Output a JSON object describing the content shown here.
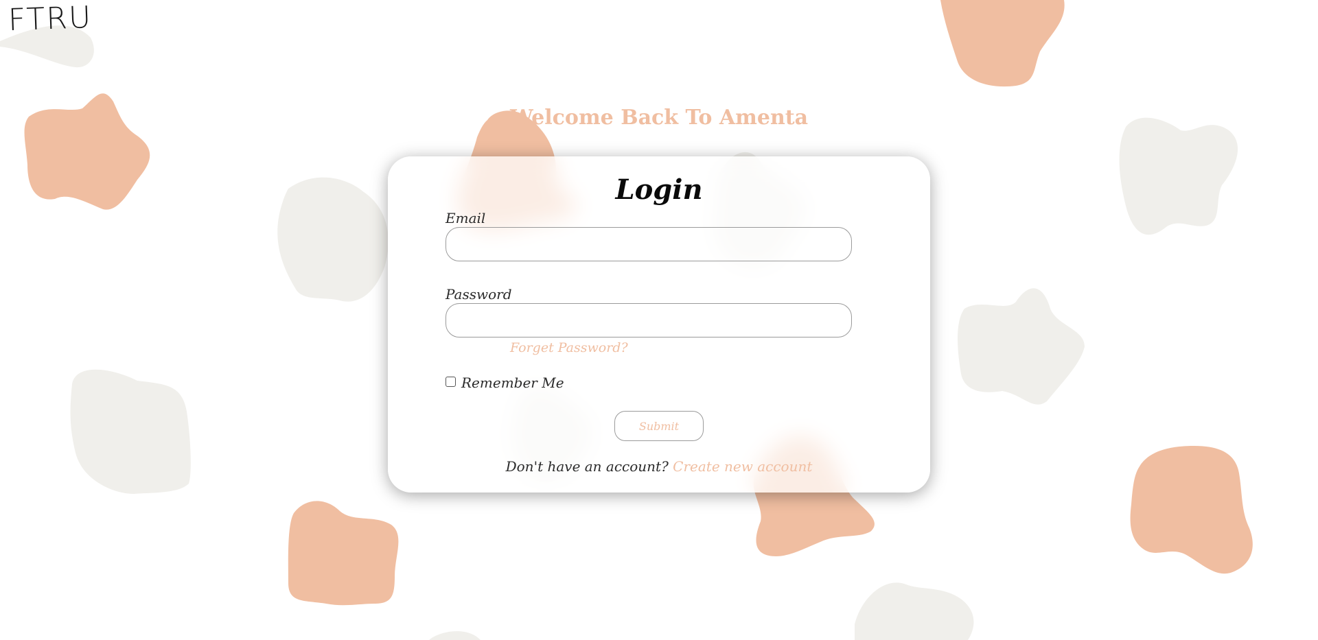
{
  "brand": {
    "logo_text": "FTRU"
  },
  "header": {
    "welcome_text": "Welcome Back To Amenta"
  },
  "login_form": {
    "title": "Login",
    "email_label": "Email",
    "email_value": "",
    "password_label": "Password",
    "password_value": "",
    "forgot_password_text": "Forget Password?",
    "remember_me_label": "Remember Me",
    "remember_me_checked": false,
    "submit_label": "Submit",
    "signup_prompt": "Don't have an account?",
    "signup_link_text": "Create new account"
  },
  "colors": {
    "accent": "#f0bea1",
    "blob_peach": "#f0bea1",
    "blob_beige": "#f0efeb",
    "text": "#2a2a2a",
    "background": "#ffffff"
  }
}
